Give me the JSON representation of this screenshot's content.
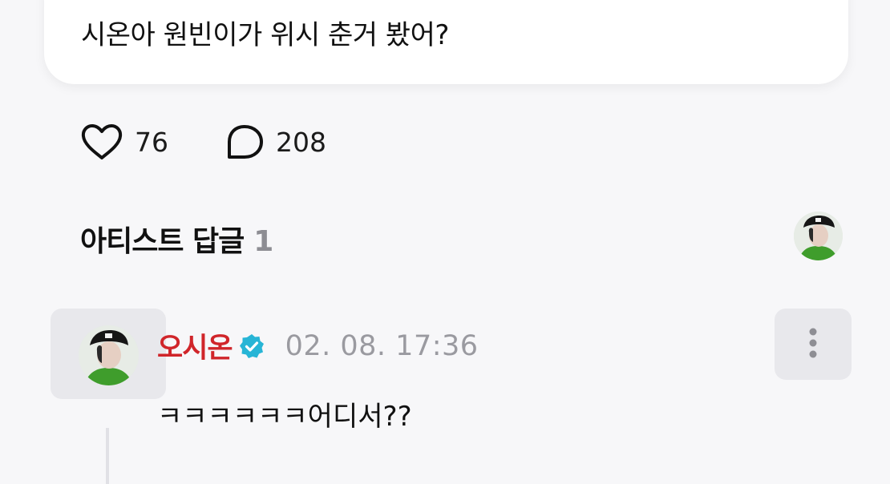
{
  "post": {
    "text": "시온아 원빈이가 위시 춘거 봤어?"
  },
  "reactions": {
    "likes": "76",
    "comments": "208"
  },
  "artist_replies": {
    "title": "아티스트 답글",
    "count": "1"
  },
  "comment": {
    "author": "오시온",
    "time": "02. 08. 17:36",
    "text": "ㅋㅋㅋㅋㅋㅋ어디서??"
  },
  "colors": {
    "author_name": "#d0252a",
    "verified_badge": "#27b5d6",
    "muted_text": "#9a9aa0"
  },
  "icons": {
    "like": "heart-outline-icon",
    "comment": "speech-bubble-outline-icon",
    "verified": "verified-badge-icon",
    "more": "vertical-ellipsis-icon"
  }
}
